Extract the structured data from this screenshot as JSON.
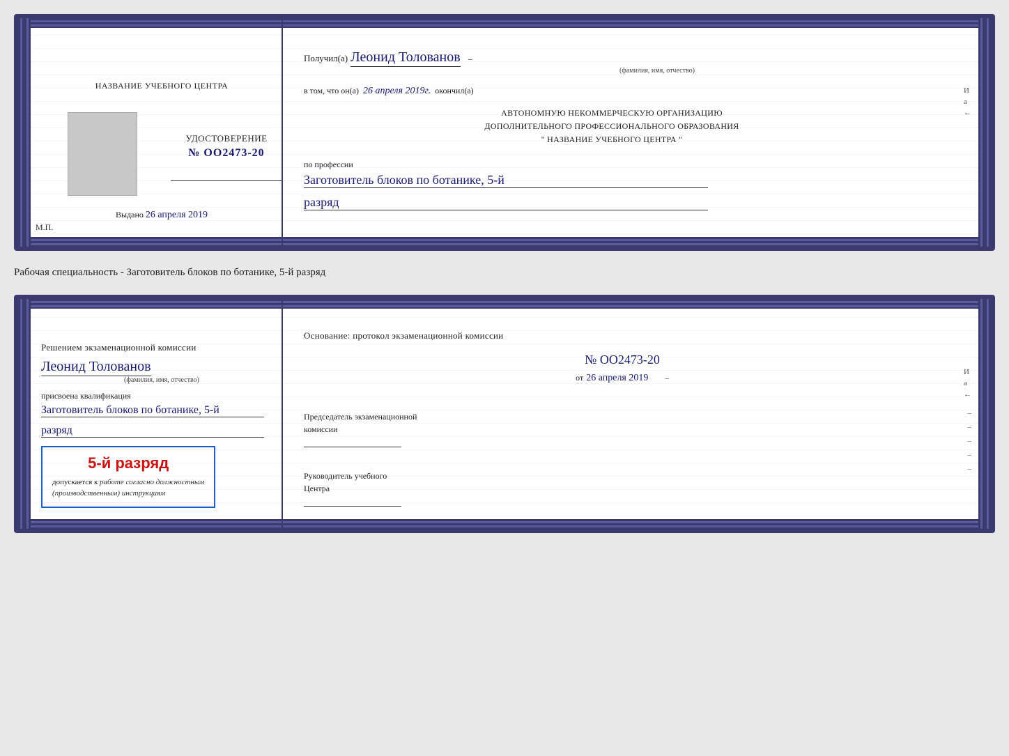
{
  "card1": {
    "left": {
      "school_name": "НАЗВАНИЕ УЧЕБНОГО ЦЕНТРА",
      "cert_title": "УДОСТОВЕРЕНИЕ",
      "cert_number": "№ OO2473-20",
      "issued_label": "Выдано",
      "issued_date": "26 апреля 2019",
      "mp_label": "М.П."
    },
    "right": {
      "received_label": "Получил(а)",
      "person_name": "Леонид Толованов",
      "name_subtitle": "(фамилия, имя, отчество)",
      "certifies_label": "в том, что он(а)",
      "certifies_date": "26 апреля 2019г.",
      "finished_label": "окончил(а)",
      "org_line1": "АВТОНОМНУЮ НЕКОММЕРЧЕСКУЮ ОРГАНИЗАЦИЮ",
      "org_line2": "ДОПОЛНИТЕЛЬНОГО ПРОФЕССИОНАЛЬНОГО ОБРАЗОВАНИЯ",
      "org_line3": "\"  НАЗВАНИЕ УЧЕБНОГО ЦЕНТРА  \"",
      "profession_label": "по профессии",
      "profession_text": "Заготовитель блоков по ботанике, 5-й",
      "rank_text": "разряд"
    }
  },
  "specialty_text": "Рабочая специальность - Заготовитель блоков по ботанике, 5-й разряд",
  "card2": {
    "left": {
      "decision_label": "Решением экзаменационной комиссии",
      "person_name": "Леонид Толованов",
      "name_subtitle": "(фамилия, имя, отчество)",
      "qualification_label": "присвоена квалификация",
      "profession_text": "Заготовитель блоков по ботанике, 5-й",
      "rank_text": "разряд",
      "stamp_rank": "5-й разряд",
      "stamp_admission_prefix": "допускается к",
      "stamp_admission_text": "работе согласно должностным",
      "stamp_admission_text2": "(производственным) инструкциям"
    },
    "right": {
      "basis_label": "Основание: протокол экзаменационной комиссии",
      "protocol_number": "№  OO2473-20",
      "from_prefix": "от",
      "from_date": "26 апреля 2019",
      "chairman_label": "Председатель экзаменационной\nкомиссии",
      "head_label": "Руководитель учебного\nЦентра"
    }
  },
  "side_chars": [
    "И",
    "а",
    "←"
  ]
}
